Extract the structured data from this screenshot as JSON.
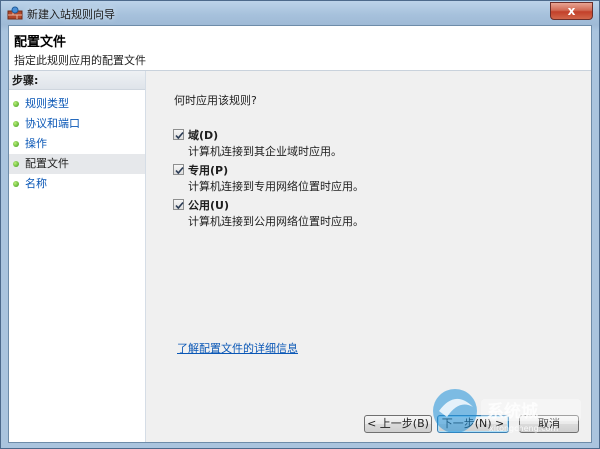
{
  "window": {
    "title": "新建入站规则向导",
    "close_glyph": "x"
  },
  "header": {
    "title": "配置文件",
    "subtitle": "指定此规则应用的配置文件"
  },
  "steps": {
    "title": "步骤:",
    "items": [
      {
        "label": "规则类型",
        "state": "link"
      },
      {
        "label": "协议和端口",
        "state": "link"
      },
      {
        "label": "操作",
        "state": "link"
      },
      {
        "label": "配置文件",
        "state": "current"
      },
      {
        "label": "名称",
        "state": "link"
      }
    ]
  },
  "main": {
    "question": "何时应用该规则?",
    "options": [
      {
        "label": "域(D)",
        "description": "计算机连接到其企业域时应用。",
        "checked": true
      },
      {
        "label": "专用(P)",
        "description": "计算机连接到专用网络位置时应用。",
        "checked": true
      },
      {
        "label": "公用(U)",
        "description": "计算机连接到公用网络位置时应用。",
        "checked": true
      }
    ],
    "learn_more": "了解配置文件的详细信息"
  },
  "buttons": {
    "back": "< 上一步(B)",
    "next": "下一步(N) >",
    "cancel": "取消"
  },
  "colors": {
    "link": "#0a57b6",
    "step_bullet": "#3f9b19",
    "close_button": "#c2402a"
  }
}
